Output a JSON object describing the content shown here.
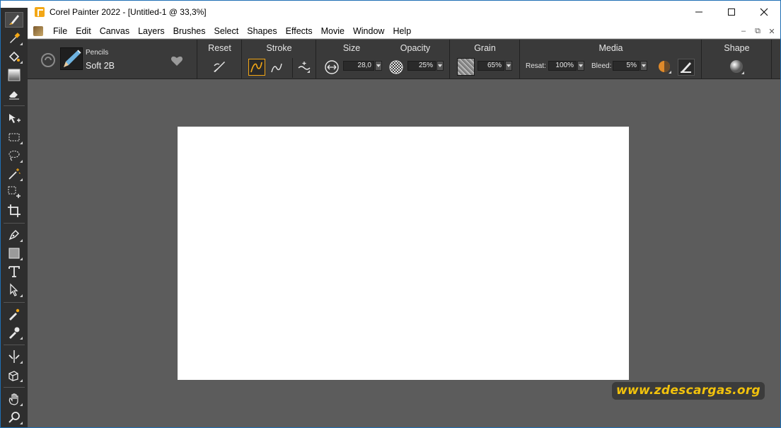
{
  "window": {
    "title": "Corel Painter 2022 - [Untitled-1 @ 33,3%]",
    "controls": [
      "minimize",
      "maximize",
      "close"
    ]
  },
  "menubar": {
    "items": [
      "File",
      "Edit",
      "Canvas",
      "Layers",
      "Brushes",
      "Select",
      "Shapes",
      "Effects",
      "Movie",
      "Window",
      "Help"
    ]
  },
  "toolbox": {
    "tools": [
      "brush-icon",
      "dropper-icon",
      "paint-bucket-icon",
      "gradient-swatch-icon",
      "eraser-icon",
      "transform-icon",
      "rect-select-icon",
      "lasso-icon",
      "magic-wand-icon",
      "selection-adjuster-icon",
      "crop-icon",
      "pen-icon",
      "rectangle-shape-icon",
      "text-icon",
      "shape-selection-icon",
      "cloner-icon",
      "rubber-stamp-icon",
      "mirror-icon",
      "perspective-guide-icon",
      "grabber-hand-icon",
      "magnifier-icon"
    ]
  },
  "propbar": {
    "brush_category": "Pencils",
    "brush_variant": "Soft 2B",
    "reset_label": "Reset",
    "stroke_label": "Stroke",
    "size_label": "Size",
    "size_value": "28,0",
    "opacity_label": "Opacity",
    "opacity_value": "25%",
    "grain_label": "Grain",
    "grain_value": "65%",
    "media_label": "Media",
    "resat_label": "Resat:",
    "resat_value": "100%",
    "bleed_label": "Bleed:",
    "bleed_value": "5%",
    "shape_label": "Shape"
  },
  "watermark": {
    "text": "www.zdescargas.org"
  },
  "colors": {
    "accent": "#f3a716",
    "workspace": "#5c5c5c",
    "panel": "#3a3a3a",
    "watermark_text": "#f2c20c"
  }
}
